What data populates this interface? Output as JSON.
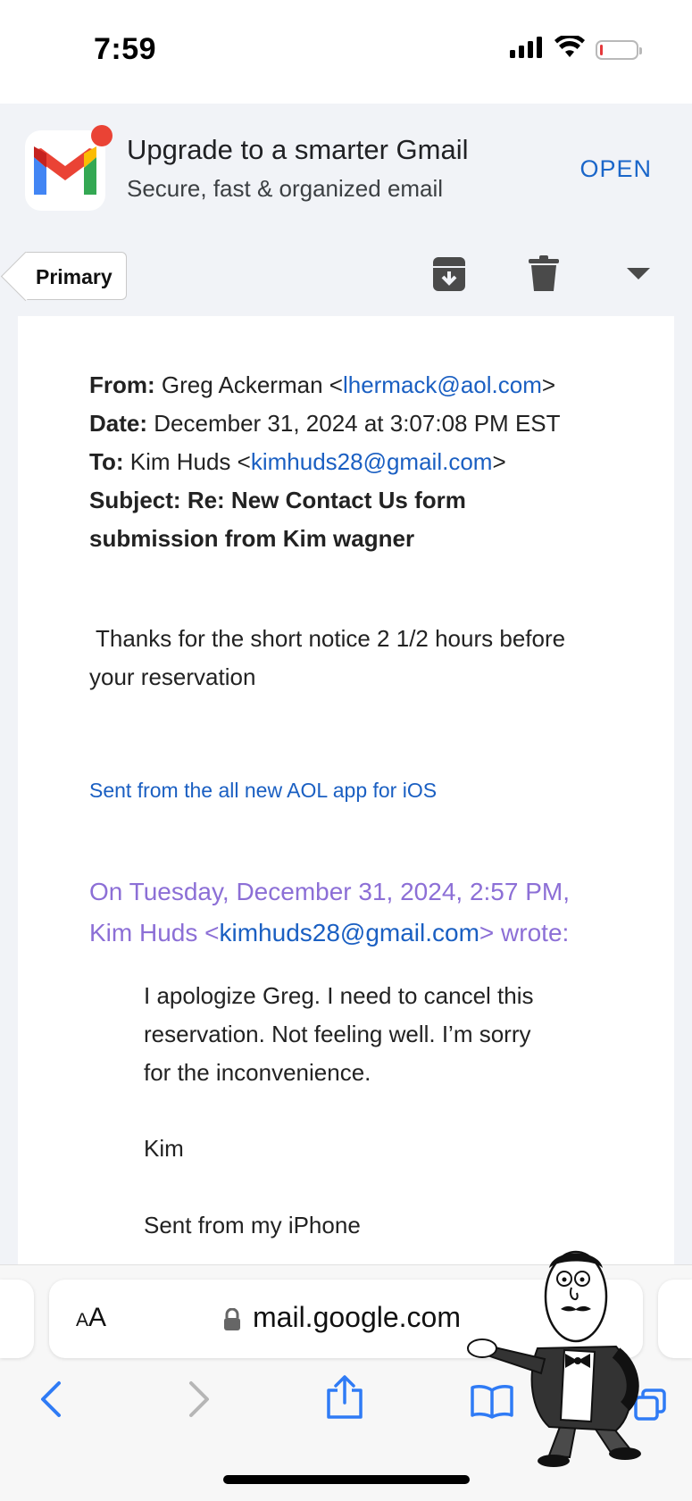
{
  "status_bar": {
    "time": "7:59"
  },
  "promo": {
    "title": "Upgrade to a smarter Gmail",
    "subtitle": "Secure, fast & organized email",
    "open_label": "OPEN"
  },
  "toolbar": {
    "back_label": "Primary",
    "icons": [
      "archive-icon",
      "trash-icon",
      "more-dropdown-icon"
    ]
  },
  "email": {
    "from_label": "From:",
    "from_name": "Greg Ackerman <",
    "from_email": "lhermack@aol.com",
    "from_close": ">",
    "date_label": "Date:",
    "date_value": "December 31, 2024 at 3:07:08 PM EST",
    "to_label": "To:",
    "to_name": "Kim Huds <",
    "to_email": "kimhuds28@gmail.com",
    "to_close": ">",
    "subject_label": "Subject:",
    "subject_value": "Re: New Contact Us form submission from Kim wagner",
    "body": "Thanks for the short notice 2 1/2 hours before your reservation",
    "signature": "Sent from the all new AOL app for iOS",
    "quote_header_1": "On Tuesday, December 31, 2024, 2:57 PM,",
    "quote_header_name": "Kim Huds <",
    "quote_header_email": "kimhuds28@gmail.com",
    "quote_header_end": "> wrote:",
    "quote_body": "I apologize Greg. I need to cancel this reservation. Not feeling well. I’m sorry for the inconvenience.",
    "quote_name": "Kim",
    "quote_signature": "Sent from my iPhone"
  },
  "safari": {
    "aa_label_small": "A",
    "aa_label_large": "A",
    "url": "mail.google.com",
    "nav_icons": [
      "back-icon",
      "forward-icon",
      "share-icon",
      "bookmarks-icon",
      "tabs-icon"
    ]
  },
  "colors": {
    "link": "#1a5fc2",
    "quote_header": "#8c6fd6",
    "banner_bg": "#f1f3f7",
    "gmail_red": "#ea4335",
    "gmail_blue": "#4285f4",
    "gmail_green": "#34a853",
    "gmail_yellow": "#fbbc04"
  }
}
